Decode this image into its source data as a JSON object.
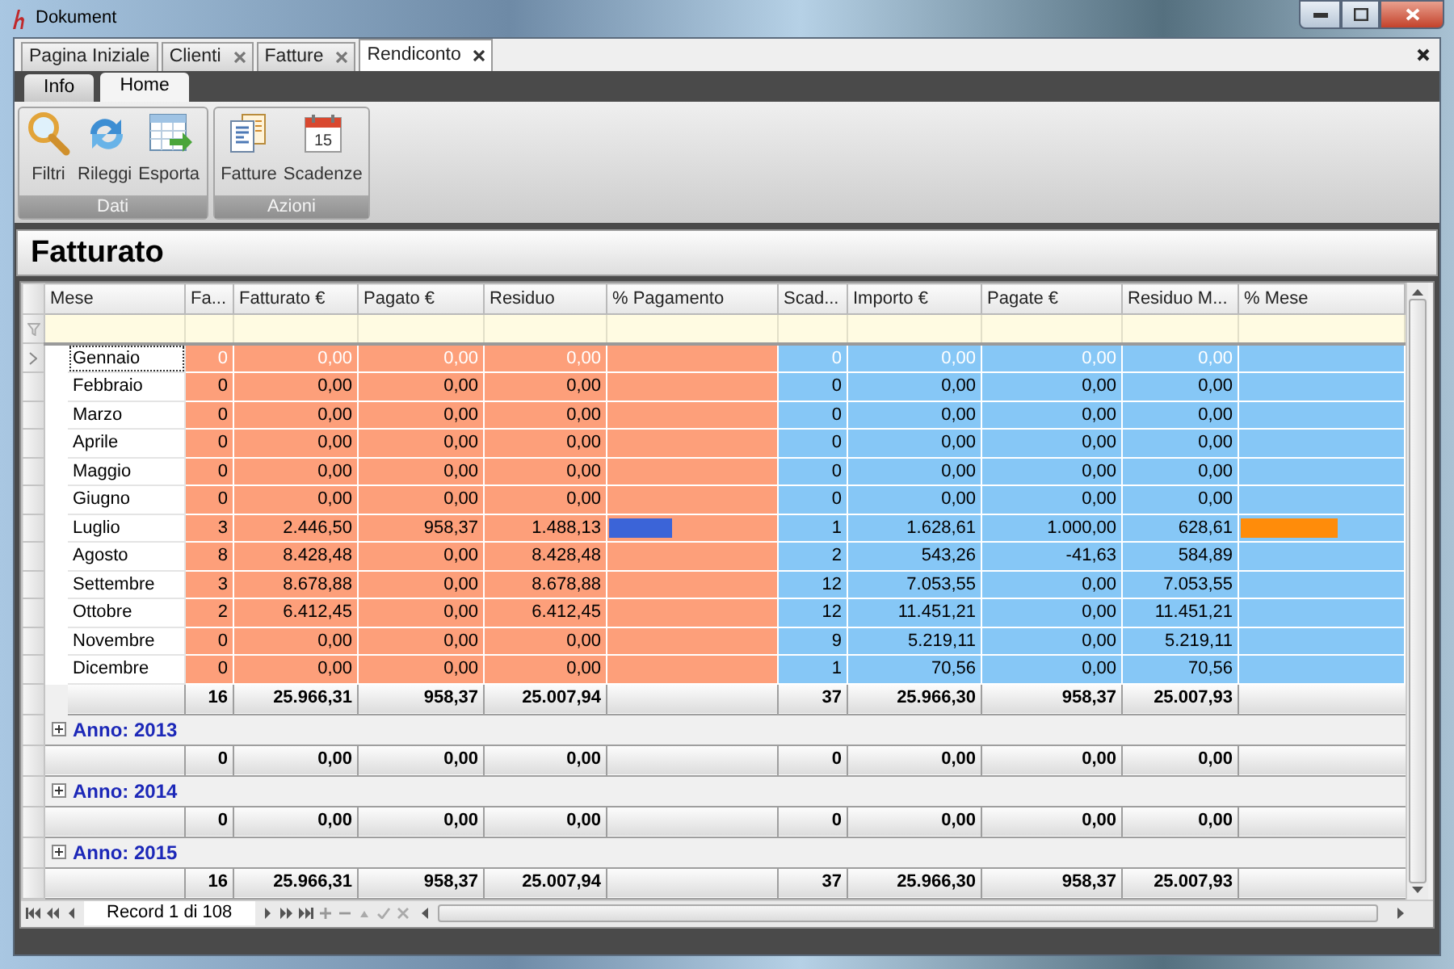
{
  "window": {
    "title": "Dokument"
  },
  "document_tabs": [
    {
      "label": "Pagina Iniziale",
      "closable": false,
      "selected": false
    },
    {
      "label": "Clienti",
      "closable": true,
      "selected": false
    },
    {
      "label": "Fatture",
      "closable": true,
      "selected": false
    },
    {
      "label": "Rendiconto",
      "closable": true,
      "selected": true
    }
  ],
  "ribbon": {
    "tabs": [
      {
        "label": "Info",
        "selected": false
      },
      {
        "label": "Home",
        "selected": true
      }
    ],
    "groups": [
      {
        "label": "Dati",
        "buttons": [
          {
            "label": "Filtri",
            "kind": "search"
          },
          {
            "label": "Rileggi",
            "kind": "refresh"
          },
          {
            "label": "Esporta",
            "kind": "export"
          }
        ]
      },
      {
        "label": "Azioni",
        "buttons": [
          {
            "label": "Fatture",
            "kind": "documents"
          },
          {
            "label": "Scadenze",
            "kind": "calendar",
            "icon_text": "15"
          }
        ]
      }
    ]
  },
  "page_title": "Fatturato",
  "grid": {
    "columns": [
      "Mese",
      "Fa...",
      "Fatturato €",
      "Pagato €",
      "Residuo",
      "% Pagamento",
      "Scad...",
      "Importo €",
      "Pagate €",
      "Residuo M...",
      "% Mese"
    ],
    "groups": [
      {
        "rows": [
          {
            "cells": [
              "Gennaio",
              "0",
              "0,00",
              "0,00",
              "0,00",
              "0",
              "0,00",
              "0,00",
              "0,00"
            ],
            "selected": true
          },
          {
            "cells": [
              "Febbraio",
              "0",
              "0,00",
              "0,00",
              "0,00",
              "0",
              "0,00",
              "0,00",
              "0,00"
            ],
            "selected": false
          },
          {
            "cells": [
              "Marzo",
              "0",
              "0,00",
              "0,00",
              "0,00",
              "0",
              "0,00",
              "0,00",
              "0,00"
            ],
            "selected": false
          },
          {
            "cells": [
              "Aprile",
              "0",
              "0,00",
              "0,00",
              "0,00",
              "0",
              "0,00",
              "0,00",
              "0,00"
            ],
            "selected": false
          },
          {
            "cells": [
              "Maggio",
              "0",
              "0,00",
              "0,00",
              "0,00",
              "0",
              "0,00",
              "0,00",
              "0,00"
            ],
            "selected": false
          },
          {
            "cells": [
              "Giugno",
              "0",
              "0,00",
              "0,00",
              "0,00",
              "0",
              "0,00",
              "0,00",
              "0,00"
            ],
            "selected": false
          },
          {
            "cells": [
              "Luglio",
              "3",
              "2.446,50",
              "958,37",
              "1.488,13",
              "1",
              "1.628,61",
              "1.000,00",
              "628,61"
            ],
            "payment_bar": {
              "level": 0.39
            },
            "month_bar": {
              "level": 0.61
            },
            "selected": false
          },
          {
            "cells": [
              "Agosto",
              "8",
              "8.428,48",
              "0,00",
              "8.428,48",
              "2",
              "543,26",
              "-41,63",
              "584,89"
            ],
            "selected": false
          },
          {
            "cells": [
              "Settembre",
              "3",
              "8.678,88",
              "0,00",
              "8.678,88",
              "12",
              "7.053,55",
              "0,00",
              "7.053,55"
            ],
            "selected": false
          },
          {
            "cells": [
              "Ottobre",
              "2",
              "6.412,45",
              "0,00",
              "6.412,45",
              "12",
              "11.451,21",
              "0,00",
              "11.451,21"
            ],
            "selected": false
          },
          {
            "cells": [
              "Novembre",
              "0",
              "0,00",
              "0,00",
              "0,00",
              "9",
              "5.219,11",
              "0,00",
              "5.219,11"
            ],
            "selected": false
          },
          {
            "cells": [
              "Dicembre",
              "0",
              "0,00",
              "0,00",
              "0,00",
              "1",
              "70,56",
              "0,00",
              "70,56"
            ],
            "selected": false
          }
        ],
        "summary": [
          "16",
          "25.966,31",
          "958,37",
          "25.007,94",
          "37",
          "25.966,30",
          "958,37",
          "25.007,93"
        ]
      },
      {
        "label": "Anno: 2013",
        "expanded": false,
        "summary": [
          "0",
          "0,00",
          "0,00",
          "0,00",
          "0",
          "0,00",
          "0,00",
          "0,00"
        ]
      },
      {
        "label": "Anno: 2014",
        "expanded": false,
        "summary": [
          "0",
          "0,00",
          "0,00",
          "0,00",
          "0",
          "0,00",
          "0,00",
          "0,00"
        ]
      },
      {
        "label": "Anno: 2015",
        "expanded": false
      }
    ],
    "grand_total": [
      "16",
      "25.966,31",
      "958,37",
      "25.007,94",
      "37",
      "25.966,30",
      "958,37",
      "25.007,93"
    ],
    "navigator": {
      "record_text": "Record 1 di 108"
    }
  }
}
